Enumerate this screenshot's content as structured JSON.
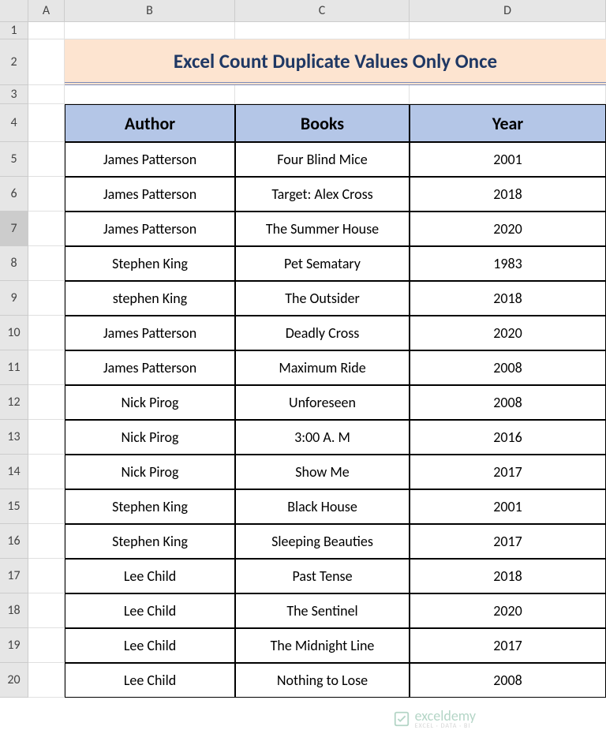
{
  "columns": [
    "A",
    "B",
    "C",
    "D"
  ],
  "row_numbers": [
    "1",
    "2",
    "3",
    "4",
    "5",
    "6",
    "7",
    "8",
    "9",
    "10",
    "11",
    "12",
    "13",
    "14",
    "15",
    "16",
    "17",
    "18",
    "19",
    "20"
  ],
  "title": "Excel Count Duplicate Values Only Once",
  "headers": {
    "author": "Author",
    "books": "Books",
    "year": "Year"
  },
  "rows": [
    {
      "author": "James Patterson",
      "book": "Four Blind Mice",
      "year": "2001"
    },
    {
      "author": "James Patterson",
      "book": "Target: Alex Cross",
      "year": "2018"
    },
    {
      "author": "James Patterson",
      "book": "The Summer House",
      "year": "2020"
    },
    {
      "author": "Stephen King",
      "book": "Pet Sematary",
      "year": "1983"
    },
    {
      "author": "stephen King",
      "book": "The Outsider",
      "year": "2018"
    },
    {
      "author": "James Patterson",
      "book": "Deadly Cross",
      "year": "2020"
    },
    {
      "author": "James Patterson",
      "book": "Maximum Ride",
      "year": "2008"
    },
    {
      "author": "Nick Pirog",
      "book": "Unforeseen",
      "year": "2008"
    },
    {
      "author": "Nick Pirog",
      "book": "3:00 A. M",
      "year": "2016"
    },
    {
      "author": "Nick Pirog",
      "book": "Show Me",
      "year": "2017"
    },
    {
      "author": "Stephen King",
      "book": "Black House",
      "year": "2001"
    },
    {
      "author": "Stephen King",
      "book": "Sleeping Beauties",
      "year": "2017"
    },
    {
      "author": "Lee Child",
      "book": "Past Tense",
      "year": "2018"
    },
    {
      "author": "Lee Child",
      "book": "The Sentinel",
      "year": "2020"
    },
    {
      "author": "Lee Child",
      "book": "The Midnight Line",
      "year": "2017"
    },
    {
      "author": "Lee Child",
      "book": "Nothing to Lose",
      "year": "2008"
    }
  ],
  "selected_row": 7,
  "watermark": {
    "brand": "exceldemy",
    "tagline": "EXCEL · DATA · BI"
  }
}
